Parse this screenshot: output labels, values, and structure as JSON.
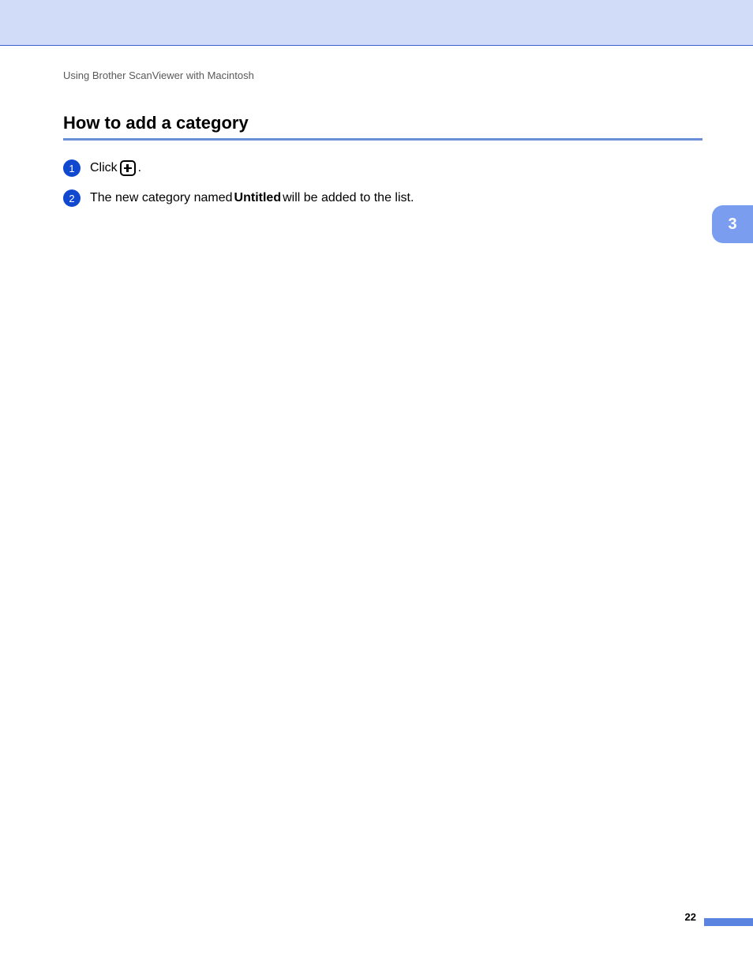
{
  "header": {
    "breadcrumb": "Using Brother ScanViewer with Macintosh"
  },
  "section": {
    "title": "How to add a category"
  },
  "steps": [
    {
      "number": "1",
      "text_before": "Click ",
      "text_after": ".",
      "has_plus_icon": true
    },
    {
      "number": "2",
      "text_before": "The new category named ",
      "bold_text": "Untitled",
      "text_after": " will be added to the list."
    }
  ],
  "chapter_tab": "3",
  "page_number": "22"
}
